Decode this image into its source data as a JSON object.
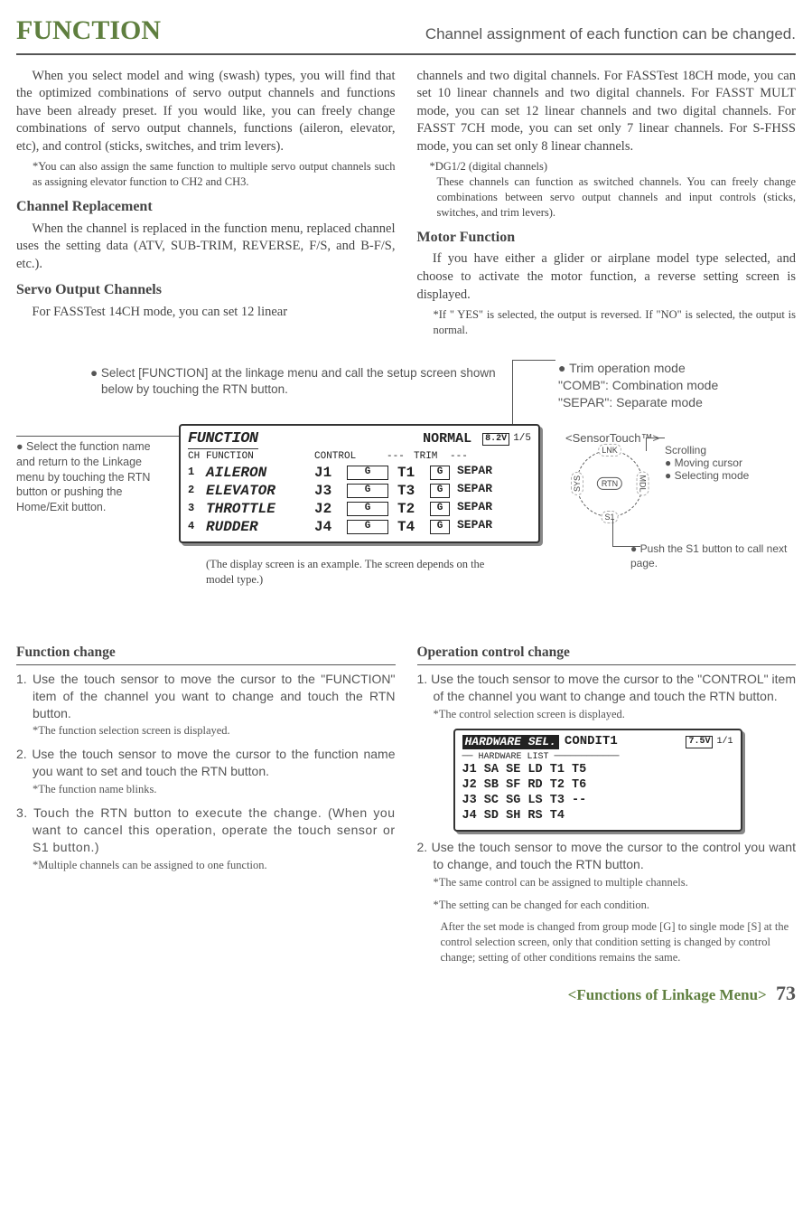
{
  "header": {
    "title": "FUNCTION",
    "subtitle": "Channel assignment of each function can be changed."
  },
  "intro_left": {
    "p1": "When you select model and wing (swash) types, you will find that the optimized combinations of servo output channels and functions have been already preset. If you would like, you can freely change combinations of servo output channels, functions (aileron, elevator, etc), and control (sticks, switches, and trim levers).",
    "note1": "*You can also assign the same function to multiple servo output channels such as assigning elevator function to CH2 and CH3.",
    "h1": "Channel Replacement",
    "p2": "When the channel is replaced in the function menu, replaced channel uses the setting data (ATV, SUB-TRIM, REVERSE, F/S, and B-F/S, etc.).",
    "h2": "Servo Output Channels",
    "p3": "For FASSTest 14CH mode, you can set 12 linear"
  },
  "intro_right": {
    "p1": "channels and two digital channels. For FASSTest 18CH mode, you can set 10 linear channels and two digital channels. For FASST MULT mode, you can set 12 linear channels and two digital channels. For FASST 7CH mode, you can set only 7 linear channels. For S-FHSS mode, you can set only 8 linear channels.",
    "note_title": "*DG1/2 (digital channels)",
    "note_body": "These channels can function as switched channels. You can freely change combinations between servo output channels and input controls (sticks, switches, and trim levers).",
    "h1": "Motor Function",
    "p2": "If you have either a glider or airplane model type selected, and choose to activate the motor function, a reverse setting screen is displayed.",
    "note2": "*If \" YES\" is selected, the output is reversed.  If \"NO\" is selected, the output is normal."
  },
  "mid": {
    "instr": "● Select [FUNCTION] at the linkage menu and call the setup screen shown below by touching the RTN button.",
    "left_callout": "● Select the function name and return to the Linkage menu by touching the RTN button or pushing the Home/Exit button.",
    "trim_title": "● Trim operation mode",
    "trim_comb": "\"COMB\": Combination mode",
    "trim_separ": "\"SEPAR\": Separate mode",
    "sensor_title": "<SensorTouch™>",
    "scrolling": "Scrolling",
    "moving": "● Moving cursor",
    "selecting": "● Selecting mode",
    "s1": "● Push the S1 button to call next page.",
    "lcd_caption": "(The display screen is an example. The screen depends on the model type.)",
    "lcd": {
      "title": "FUNCTION",
      "normal": "NORMAL",
      "batt": "8.2V",
      "page": "1/5",
      "hdr_ch": "CH",
      "hdr_fn": "FUNCTION",
      "hdr_ctrl": "CONTROL",
      "hdr_trim_dash": "---",
      "hdr_trim": "TRIM",
      "hdr_trim_dash2": "---",
      "rows": [
        {
          "n": "1",
          "fn": "AILERON",
          "c": "J1",
          "cg": "G",
          "t": "T1",
          "tg": "G",
          "m": "SEPAR"
        },
        {
          "n": "2",
          "fn": "ELEVATOR",
          "c": "J3",
          "cg": "G",
          "t": "T3",
          "tg": "G",
          "m": "SEPAR"
        },
        {
          "n": "3",
          "fn": "THROTTLE",
          "c": "J2",
          "cg": "G",
          "t": "T2",
          "tg": "G",
          "m": "SEPAR"
        },
        {
          "n": "4",
          "fn": "RUDDER",
          "c": "J4",
          "cg": "G",
          "t": "T4",
          "tg": "G",
          "m": "SEPAR"
        }
      ]
    },
    "sensor_labels": {
      "lnk": "LNK",
      "sys": "SYS",
      "mdl": "MDL",
      "rtn": "RTN",
      "s1": "S1"
    }
  },
  "fc": {
    "h": "Function change",
    "s1": "1. Use the touch sensor to move the cursor to the \"FUNCTION\" item of the channel you want to change and touch the RTN button.",
    "n1": "*The function selection screen is displayed.",
    "s2": "2. Use the touch sensor to move the cursor to the function name you want to set and touch the RTN button.",
    "n2": "*The function name blinks.",
    "s3": "3. Touch the RTN button to execute the change. (When you want to cancel this operation, operate the touch sensor or S1 button.)",
    "n3": "*Multiple channels can be assigned to one function."
  },
  "oc": {
    "h": "Operation control change",
    "s1": "1. Use the touch sensor to move the cursor to the \"CONTROL\" item of the channel you want to change and touch the RTN button.",
    "n1": "*The control selection screen is displayed.",
    "lcd": {
      "title": "HARDWARE SEL.",
      "cond": "CONDIT1",
      "batt": "7.5V",
      "pg": "1/1",
      "listlabel": "HARDWARE LIST",
      "r1": "J1 SA SE LD T1 T5",
      "r2": "J2 SB SF RD T2 T6",
      "r3": "J3 SC SG LS T3 --",
      "r4": "J4 SD SH RS T4"
    },
    "s2": "2. Use the touch sensor to move the cursor to the control you want to change, and touch the RTN button.",
    "n2": "*The same control can be assigned to multiple channels.",
    "n3": "*The setting can be changed for each condition.",
    "n4": "After the set mode is changed from group mode [G] to single mode [S] at the control selection screen, only that condition setting is changed by control change; setting of other conditions remains the same."
  },
  "footer": {
    "label": "<Functions of Linkage Menu>",
    "page": "73"
  }
}
